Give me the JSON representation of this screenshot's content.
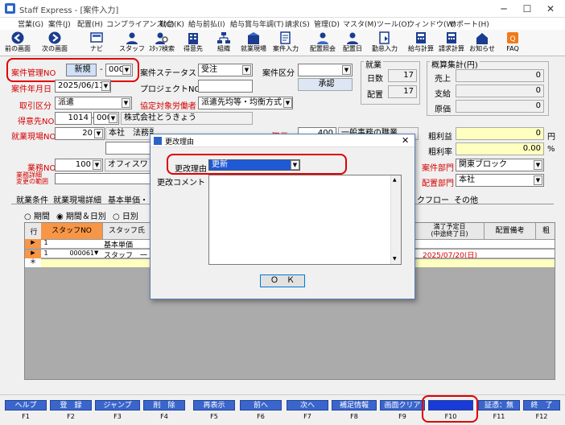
{
  "window": {
    "title": "Staff Express - [案件入力]"
  },
  "menu": [
    "営業(G)",
    "案件(J)",
    "配置(H)",
    "コンプライアンス(C)",
    "勤怠(K)",
    "給与前払(I)",
    "給与賞与年調(T)",
    "請求(S)",
    "管理(D)",
    "マスタ(M)",
    "ツール(O)",
    "ウィンドウ(W)",
    "サポート(H)"
  ],
  "toolbar": [
    {
      "label": "前の画面",
      "icon": "back-arrow-icon"
    },
    {
      "label": "次の画面",
      "icon": "forward-arrow-icon"
    },
    {
      "label": "ナビ",
      "icon": "navi-icon"
    },
    {
      "label": "スタッフ",
      "icon": "staff-icon"
    },
    {
      "label": "ｽﾀｯﾌ検索",
      "icon": "staff-search-icon"
    },
    {
      "label": "得意先",
      "icon": "client-icon"
    },
    {
      "label": "組織",
      "icon": "organization-icon"
    },
    {
      "label": "就業現場",
      "icon": "worksite-icon"
    },
    {
      "label": "案件入力",
      "icon": "case-entry-icon"
    },
    {
      "label": "配置照会",
      "icon": "placement-inquiry-icon"
    },
    {
      "label": "配置日",
      "icon": "placement-day-icon"
    },
    {
      "label": "勤怠入力",
      "icon": "attendance-icon"
    },
    {
      "label": "給与計算",
      "icon": "payroll-icon"
    },
    {
      "label": "請求計算",
      "icon": "billing-icon"
    },
    {
      "label": "お知らせ",
      "icon": "notice-icon"
    },
    {
      "label": "FAQ",
      "icon": "faq-icon"
    }
  ],
  "form": {
    "case_no_label": "案件管理NO",
    "case_no_value": "新規",
    "case_no_suffix": "000",
    "dash": "-",
    "status_label": "案件ステータス",
    "status_value": "受注",
    "category_label": "案件区分",
    "date_label": "案件年月日",
    "date_value": "2025/06/11",
    "project_label": "プロジェクトNO",
    "approval_btn": "承認",
    "deal_type_label": "取引区分",
    "deal_type_value": "派遣",
    "agreement_label": "協定対象労働者",
    "agreement_value": "派遣先均等・均衡方式",
    "client_label": "得意先NO",
    "client_no": "1014",
    "client_suffix": "000",
    "client_name": "株式会社とうきょう",
    "site_label": "就業現場NO",
    "site_no": "20",
    "site_name": "本社　法務部",
    "job_label": "業務NO",
    "job_no": "100",
    "job_name": "オフィスワ",
    "job_detail_label": "業務詳細\n変更の範囲",
    "hidden_label": "職業NO",
    "hidden_no": "400",
    "hidden_btn": "一般事務の職業"
  },
  "summary": {
    "work_title": "就業",
    "days_label": "日数",
    "days_value": "17",
    "assign_label": "配置",
    "assign_value": "17",
    "calc_title": "概算集計(円)",
    "sales_label": "売上",
    "sales_value": "0",
    "pay_label": "支給",
    "pay_value": "0",
    "cost_label": "原価",
    "cost_value": "0",
    "profit_label": "粗利益",
    "profit_value": "0",
    "profit_unit": "円",
    "margin_label": "粗利率",
    "margin_value": "0.00",
    "margin_unit": "%",
    "dept_label": "案件部門",
    "dept_value": "関東ブロック",
    "place_dept_label": "配置部門",
    "place_dept_value": "本社"
  },
  "tabs": [
    "就業条件",
    "就業現場詳細",
    "基本単価・",
    "クフロー",
    "その他"
  ],
  "radio": {
    "opt1": "期間",
    "opt2": "期間＆日別",
    "opt3": "日別"
  },
  "grid": {
    "headers": [
      "行",
      "スタッフNO",
      "スタッフ氏",
      "満了予定日\n(中途終了日)",
      "配置備考",
      "粗"
    ],
    "row_subheader": "基本単価",
    "rows": [
      {
        "num": "1",
        "staff_no": "000061",
        "staff_name": "スタッフ　一",
        "end_date": "2025/07/20(日)"
      }
    ],
    "new_marker": "＊"
  },
  "dialog": {
    "title": "更改理由",
    "reason_label": "更改理由",
    "reason_value": "更新",
    "comment_label": "更改コメント",
    "ok": "Ｏ　Ｋ"
  },
  "fkeys": [
    {
      "label": "ヘルプ",
      "key": "F1"
    },
    {
      "label": "登　録",
      "key": "F2"
    },
    {
      "label": "ジャンプ",
      "key": "F3"
    },
    {
      "label": "削　除",
      "key": "F4"
    },
    {
      "label": "再表示",
      "key": "F5"
    },
    {
      "label": "前へ",
      "key": "F6"
    },
    {
      "label": "次へ",
      "key": "F7"
    },
    {
      "label": "補足情報",
      "key": "F8"
    },
    {
      "label": "画面クリア",
      "key": "F9"
    },
    {
      "label": "",
      "key": "F10"
    },
    {
      "label": "証憑：無",
      "key": "F11"
    },
    {
      "label": "終　了",
      "key": "F12"
    }
  ],
  "colors": {
    "accent": "#3a66cc",
    "highlight": "#e00000",
    "required_label": "#d40000"
  }
}
